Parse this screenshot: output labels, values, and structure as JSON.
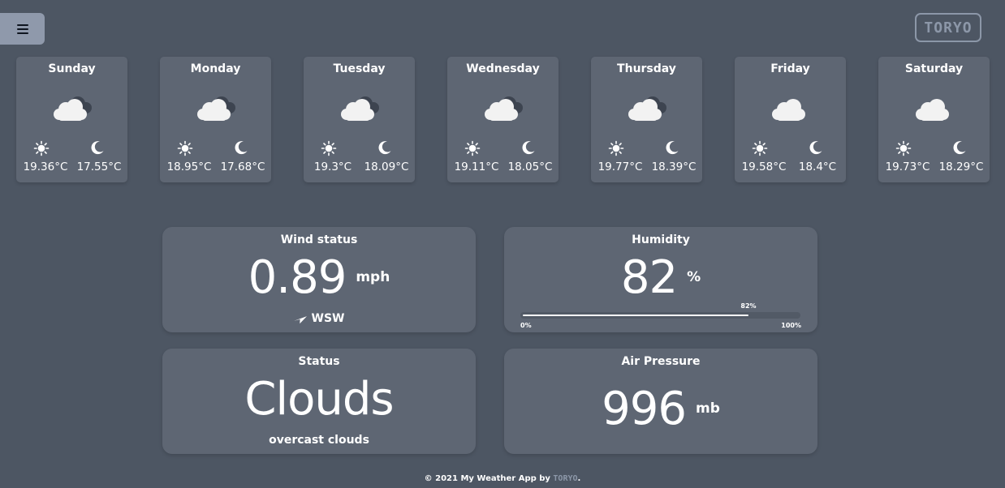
{
  "header": {
    "logo": "TORYO"
  },
  "days": [
    {
      "name": "Sunday",
      "icon": "broken-clouds-icon",
      "day_temp": "19.36°C",
      "night_temp": "17.55°C"
    },
    {
      "name": "Monday",
      "icon": "broken-clouds-icon",
      "day_temp": "18.95°C",
      "night_temp": "17.68°C"
    },
    {
      "name": "Tuesday",
      "icon": "broken-clouds-icon",
      "day_temp": "19.3°C",
      "night_temp": "18.09°C"
    },
    {
      "name": "Wednesday",
      "icon": "broken-clouds-icon",
      "day_temp": "19.11°C",
      "night_temp": "18.05°C"
    },
    {
      "name": "Thursday",
      "icon": "broken-clouds-icon",
      "day_temp": "19.77°C",
      "night_temp": "18.39°C"
    },
    {
      "name": "Friday",
      "icon": "cloud-icon",
      "day_temp": "19.58°C",
      "night_temp": "18.4°C"
    },
    {
      "name": "Saturday",
      "icon": "cloud-icon",
      "day_temp": "19.73°C",
      "night_temp": "18.29°C"
    }
  ],
  "wind": {
    "title": "Wind status",
    "value": "0.89",
    "unit": "mph",
    "direction": "WSW"
  },
  "humidity": {
    "title": "Humidity",
    "value": "82",
    "unit": "%",
    "percent": 82,
    "percent_label": "82%",
    "min_label": "0%",
    "max_label": "100%"
  },
  "status": {
    "title": "Status",
    "value": "Clouds",
    "description": "overcast clouds"
  },
  "pressure": {
    "title": "Air Pressure",
    "value": "996",
    "unit": "mb"
  },
  "footer": {
    "text": "© 2021 My Weather App by ",
    "brand": "TORYO",
    "end": "."
  },
  "colors": {
    "background": "#4d5663",
    "card": "#5e6673",
    "menu_button": "#8f99ab",
    "brand": "#8c97a8"
  }
}
